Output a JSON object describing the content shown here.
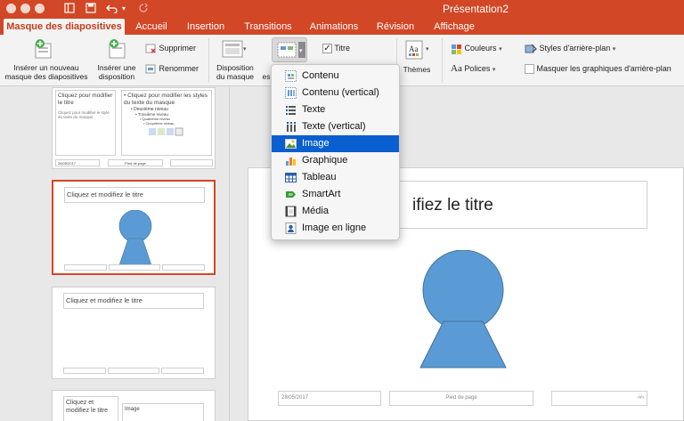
{
  "window": {
    "title": "Présentation2"
  },
  "tabs": [
    {
      "label": "Masque des diapositives",
      "active": true
    },
    {
      "label": "Accueil"
    },
    {
      "label": "Insertion"
    },
    {
      "label": "Transitions"
    },
    {
      "label": "Animations"
    },
    {
      "label": "Révision"
    },
    {
      "label": "Affichage"
    }
  ],
  "ribbon": {
    "insert_master_line1": "Insérer un nouveau",
    "insert_master_line2": "masque des diapositives",
    "insert_layout_line1": "Insérer une",
    "insert_layout_line2": "disposition",
    "delete": "Supprimer",
    "rename": "Renommer",
    "master_layout_line1": "Disposition",
    "master_layout_line2": "du masque",
    "insert_placeholder_partial": "es",
    "title_checkbox": "Titre",
    "title_checked": true,
    "themes": "Thèmes",
    "colors": "Couleurs",
    "fonts": "Polices",
    "background_styles": "Styles d'arrière-plan",
    "hide_background": "Masquer les graphiques d'arrière-plan",
    "hide_background_checked": false
  },
  "placeholder_menu": {
    "items": [
      {
        "label": "Contenu",
        "icon": "content-icon"
      },
      {
        "label": "Contenu (vertical)",
        "icon": "content-vertical-icon"
      },
      {
        "label": "Texte",
        "icon": "text-icon"
      },
      {
        "label": "Texte (vertical)",
        "icon": "text-vertical-icon"
      },
      {
        "label": "Image",
        "icon": "image-icon",
        "highlighted": true
      },
      {
        "label": "Graphique",
        "icon": "chart-icon"
      },
      {
        "label": "Tableau",
        "icon": "table-icon"
      },
      {
        "label": "SmartArt",
        "icon": "smartart-icon"
      },
      {
        "label": "Média",
        "icon": "media-icon"
      },
      {
        "label": "Image en ligne",
        "icon": "online-image-icon"
      }
    ]
  },
  "thumbnails": {
    "t1_left_title": "Cliquez pour modifier le titre",
    "t1_left_sub": "Cliquez pour modifier le style du texte du masque",
    "t1_bullet1": "• Cliquez pour modifier les styles du texte du masque",
    "t1_bullet2": "• Deuxième niveau",
    "t1_bullet3": "• Troisième niveau",
    "t1_bullet4": "• Quatrième niveau",
    "t1_bullet5": "• Cinquième niveau",
    "t1_date": "28/05/2017",
    "t1_footer": "Pied de page",
    "t2_title": "Cliquez et modifiez le titre",
    "t3_title": "Cliquez et modifiez le titre",
    "t4_title": "Cliquez et modifiez le titre",
    "t4_image": "Image"
  },
  "slide": {
    "title_visible": "ifiez le titre",
    "date": "28/05/2017",
    "footer": "Pied de page",
    "page_number": "‹#›"
  },
  "colors": {
    "accent": "#d24726",
    "shape": "#5b9bd5",
    "highlight": "#0a5fd0"
  }
}
